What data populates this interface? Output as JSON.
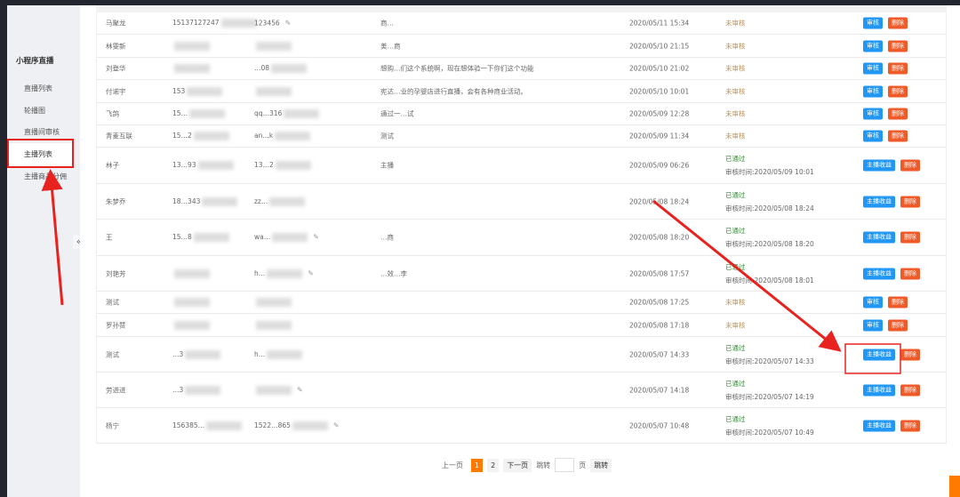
{
  "sidebar": {
    "title": "小程序直播",
    "items": [
      {
        "label": "直播列表"
      },
      {
        "label": "轮播图"
      },
      {
        "label": "直播间审核"
      },
      {
        "label": "主播列表",
        "active": true
      },
      {
        "label": "主播商品分佣"
      }
    ],
    "collapse": "«"
  },
  "table": {
    "rows": [
      {
        "name": "马聚龙",
        "phone": "15137127247",
        "pwd": "123456",
        "edit": true,
        "intro": "商…",
        "time": "2020/05/11 15:34",
        "status": "未审核",
        "actions": [
          "审核",
          "删除"
        ]
      },
      {
        "name": "林雯新",
        "phone": "",
        "pwd": "",
        "intro": "美…商",
        "time": "2020/05/10 21:15",
        "status": "未审核",
        "actions": [
          "审核",
          "删除"
        ]
      },
      {
        "name": "刘登华",
        "phone": "",
        "pwd": "…08",
        "intro": "想购…们这个系统啊，现在想体验一下你们这个功能",
        "time": "2020/05/10 21:02",
        "status": "未审核",
        "actions": [
          "审核",
          "删除"
        ]
      },
      {
        "name": "付诺宇",
        "phone": "153",
        "pwd": "",
        "intro": "宪达…业的孕婴店进行直播，会有各种商业活动。",
        "time": "2020/05/10 10:01",
        "status": "未审核",
        "actions": [
          "审核",
          "删除"
        ]
      },
      {
        "name": "飞鸽",
        "phone": "15…",
        "pwd": "qq…316",
        "intro": "通过一…试",
        "time": "2020/05/09 12:28",
        "status": "未审核",
        "actions": [
          "审核",
          "删除"
        ]
      },
      {
        "name": "青麦互联",
        "phone": "15…2",
        "pwd": "an…k",
        "intro": "测试",
        "time": "2020/05/09 11:34",
        "status": "未审核",
        "actions": [
          "审核",
          "删除"
        ]
      },
      {
        "name": "林子",
        "phone": "13…93",
        "pwd": "13…2",
        "intro": "主播",
        "time": "2020/05/09 06:26",
        "status": "已通过",
        "review_time": "审核时间:2020/05/09 10:01",
        "actions": [
          "主播收益",
          "删除"
        ]
      },
      {
        "name": "朱梦乔",
        "phone": "18…343",
        "pwd": "zz…",
        "intro": "",
        "time": "2020/05/08 18:24",
        "status": "已通过",
        "review_time": "审核时间:2020/05/08 18:24",
        "actions": [
          "主播收益",
          "删除"
        ]
      },
      {
        "name": "王",
        "phone": "15…8",
        "pwd": "wa…",
        "edit": true,
        "intro": "…商",
        "time": "2020/05/08 18:20",
        "status": "已通过",
        "review_time": "审核时间:2020/05/08 18:20",
        "actions": [
          "主播收益",
          "删除"
        ]
      },
      {
        "name": "刘艳芳",
        "phone": "",
        "pwd": "h…",
        "edit": true,
        "intro": "…效…李",
        "time": "2020/05/08 17:57",
        "status": "已通过",
        "review_time": "审核时间:2020/05/08 18:01",
        "actions": [
          "主播收益",
          "删除"
        ]
      },
      {
        "name": "测试",
        "phone": "",
        "pwd": "",
        "intro": "",
        "time": "2020/05/08 17:25",
        "status": "未审核",
        "actions": [
          "审核",
          "删除"
        ]
      },
      {
        "name": "罗孙赞",
        "phone": "",
        "pwd": "",
        "intro": "",
        "time": "2020/05/08 17:18",
        "status": "未审核",
        "actions": [
          "审核",
          "删除"
        ]
      },
      {
        "name": "测试",
        "phone": "…3",
        "pwd": "h…",
        "intro": "",
        "time": "2020/05/07 14:33",
        "status": "已通过",
        "review_time": "审核时间:2020/05/07 14:33",
        "actions": [
          "主播收益",
          "删除"
        ]
      },
      {
        "name": "劳进进",
        "phone": "…3",
        "pwd": "",
        "edit": true,
        "intro": "",
        "time": "2020/05/07 14:18",
        "status": "已通过",
        "review_time": "审核时间:2020/05/07 14:19",
        "actions": [
          "主播收益",
          "删除"
        ]
      },
      {
        "name": "杨宁",
        "phone": "156385…",
        "pwd": "1522…865",
        "edit": true,
        "intro": "",
        "time": "2020/05/07 10:48",
        "status": "已通过",
        "review_time": "审核时间:2020/05/07 10:49",
        "actions": [
          "主播收益",
          "删除"
        ]
      }
    ]
  },
  "pager": {
    "prev": "上一页",
    "pages": [
      "1",
      "2"
    ],
    "current": "1",
    "next": "下一页",
    "jump_label": "跳转",
    "jump_value": "",
    "page_unit": "页",
    "jump_button": "跳转"
  },
  "colors": {
    "accent": "#ff7a00",
    "blue": "#2196f3",
    "red": "#f05a28",
    "annotation": "#e8231f"
  }
}
